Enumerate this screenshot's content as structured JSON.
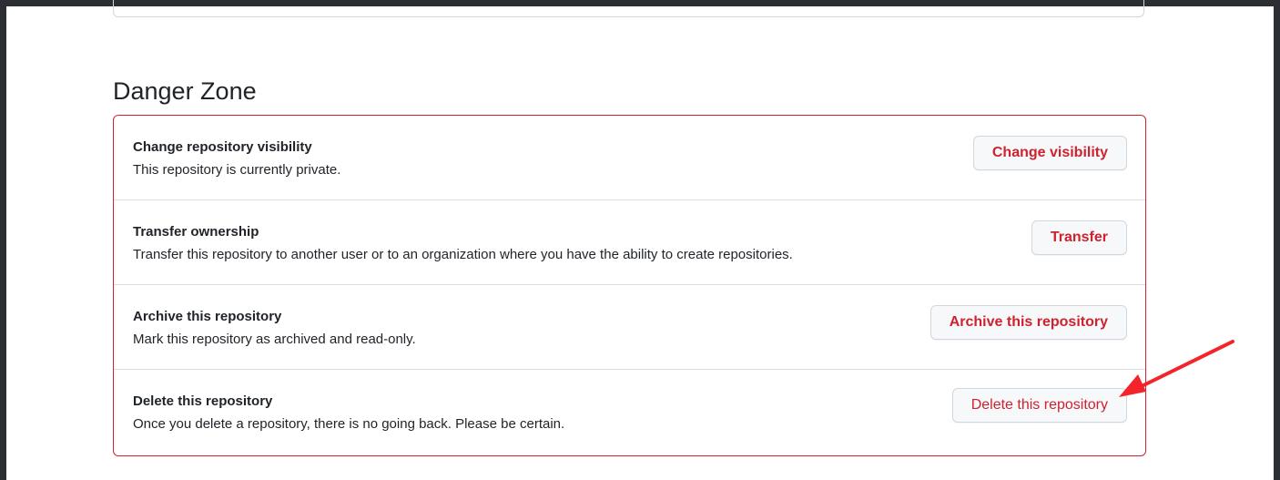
{
  "danger_zone": {
    "title": "Danger Zone",
    "rows": [
      {
        "title": "Change repository visibility",
        "description": "This repository is currently private.",
        "button": "Change visibility"
      },
      {
        "title": "Transfer ownership",
        "description": "Transfer this repository to another user or to an organization where you have the ability to create repositories.",
        "button": "Transfer"
      },
      {
        "title": "Archive this repository",
        "description": "Mark this repository as archived and read-only.",
        "button": "Archive this repository"
      },
      {
        "title": "Delete this repository",
        "description": "Once you delete a repository, there is no going back. Please be certain.",
        "button": "Delete this repository"
      }
    ]
  },
  "colors": {
    "danger": "#cf222e",
    "annotation_arrow": "#f5242b",
    "window_bg": "#2b2f33"
  },
  "annotation": {
    "icon": "red-arrow-icon"
  }
}
